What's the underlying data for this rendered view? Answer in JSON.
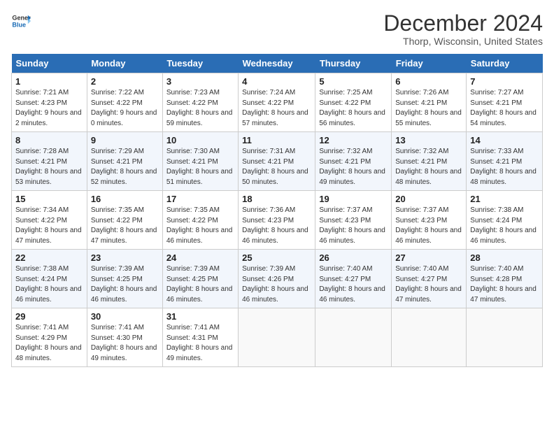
{
  "logo": {
    "line1": "General",
    "line2": "Blue"
  },
  "title": "December 2024",
  "subtitle": "Thorp, Wisconsin, United States",
  "days_header": [
    "Sunday",
    "Monday",
    "Tuesday",
    "Wednesday",
    "Thursday",
    "Friday",
    "Saturday"
  ],
  "weeks": [
    [
      {
        "day": "1",
        "sunrise": "Sunrise: 7:21 AM",
        "sunset": "Sunset: 4:23 PM",
        "daylight": "Daylight: 9 hours and 2 minutes."
      },
      {
        "day": "2",
        "sunrise": "Sunrise: 7:22 AM",
        "sunset": "Sunset: 4:22 PM",
        "daylight": "Daylight: 9 hours and 0 minutes."
      },
      {
        "day": "3",
        "sunrise": "Sunrise: 7:23 AM",
        "sunset": "Sunset: 4:22 PM",
        "daylight": "Daylight: 8 hours and 59 minutes."
      },
      {
        "day": "4",
        "sunrise": "Sunrise: 7:24 AM",
        "sunset": "Sunset: 4:22 PM",
        "daylight": "Daylight: 8 hours and 57 minutes."
      },
      {
        "day": "5",
        "sunrise": "Sunrise: 7:25 AM",
        "sunset": "Sunset: 4:22 PM",
        "daylight": "Daylight: 8 hours and 56 minutes."
      },
      {
        "day": "6",
        "sunrise": "Sunrise: 7:26 AM",
        "sunset": "Sunset: 4:21 PM",
        "daylight": "Daylight: 8 hours and 55 minutes."
      },
      {
        "day": "7",
        "sunrise": "Sunrise: 7:27 AM",
        "sunset": "Sunset: 4:21 PM",
        "daylight": "Daylight: 8 hours and 54 minutes."
      }
    ],
    [
      {
        "day": "8",
        "sunrise": "Sunrise: 7:28 AM",
        "sunset": "Sunset: 4:21 PM",
        "daylight": "Daylight: 8 hours and 53 minutes."
      },
      {
        "day": "9",
        "sunrise": "Sunrise: 7:29 AM",
        "sunset": "Sunset: 4:21 PM",
        "daylight": "Daylight: 8 hours and 52 minutes."
      },
      {
        "day": "10",
        "sunrise": "Sunrise: 7:30 AM",
        "sunset": "Sunset: 4:21 PM",
        "daylight": "Daylight: 8 hours and 51 minutes."
      },
      {
        "day": "11",
        "sunrise": "Sunrise: 7:31 AM",
        "sunset": "Sunset: 4:21 PM",
        "daylight": "Daylight: 8 hours and 50 minutes."
      },
      {
        "day": "12",
        "sunrise": "Sunrise: 7:32 AM",
        "sunset": "Sunset: 4:21 PM",
        "daylight": "Daylight: 8 hours and 49 minutes."
      },
      {
        "day": "13",
        "sunrise": "Sunrise: 7:32 AM",
        "sunset": "Sunset: 4:21 PM",
        "daylight": "Daylight: 8 hours and 48 minutes."
      },
      {
        "day": "14",
        "sunrise": "Sunrise: 7:33 AM",
        "sunset": "Sunset: 4:21 PM",
        "daylight": "Daylight: 8 hours and 48 minutes."
      }
    ],
    [
      {
        "day": "15",
        "sunrise": "Sunrise: 7:34 AM",
        "sunset": "Sunset: 4:22 PM",
        "daylight": "Daylight: 8 hours and 47 minutes."
      },
      {
        "day": "16",
        "sunrise": "Sunrise: 7:35 AM",
        "sunset": "Sunset: 4:22 PM",
        "daylight": "Daylight: 8 hours and 47 minutes."
      },
      {
        "day": "17",
        "sunrise": "Sunrise: 7:35 AM",
        "sunset": "Sunset: 4:22 PM",
        "daylight": "Daylight: 8 hours and 46 minutes."
      },
      {
        "day": "18",
        "sunrise": "Sunrise: 7:36 AM",
        "sunset": "Sunset: 4:23 PM",
        "daylight": "Daylight: 8 hours and 46 minutes."
      },
      {
        "day": "19",
        "sunrise": "Sunrise: 7:37 AM",
        "sunset": "Sunset: 4:23 PM",
        "daylight": "Daylight: 8 hours and 46 minutes."
      },
      {
        "day": "20",
        "sunrise": "Sunrise: 7:37 AM",
        "sunset": "Sunset: 4:23 PM",
        "daylight": "Daylight: 8 hours and 46 minutes."
      },
      {
        "day": "21",
        "sunrise": "Sunrise: 7:38 AM",
        "sunset": "Sunset: 4:24 PM",
        "daylight": "Daylight: 8 hours and 46 minutes."
      }
    ],
    [
      {
        "day": "22",
        "sunrise": "Sunrise: 7:38 AM",
        "sunset": "Sunset: 4:24 PM",
        "daylight": "Daylight: 8 hours and 46 minutes."
      },
      {
        "day": "23",
        "sunrise": "Sunrise: 7:39 AM",
        "sunset": "Sunset: 4:25 PM",
        "daylight": "Daylight: 8 hours and 46 minutes."
      },
      {
        "day": "24",
        "sunrise": "Sunrise: 7:39 AM",
        "sunset": "Sunset: 4:25 PM",
        "daylight": "Daylight: 8 hours and 46 minutes."
      },
      {
        "day": "25",
        "sunrise": "Sunrise: 7:39 AM",
        "sunset": "Sunset: 4:26 PM",
        "daylight": "Daylight: 8 hours and 46 minutes."
      },
      {
        "day": "26",
        "sunrise": "Sunrise: 7:40 AM",
        "sunset": "Sunset: 4:27 PM",
        "daylight": "Daylight: 8 hours and 46 minutes."
      },
      {
        "day": "27",
        "sunrise": "Sunrise: 7:40 AM",
        "sunset": "Sunset: 4:27 PM",
        "daylight": "Daylight: 8 hours and 47 minutes."
      },
      {
        "day": "28",
        "sunrise": "Sunrise: 7:40 AM",
        "sunset": "Sunset: 4:28 PM",
        "daylight": "Daylight: 8 hours and 47 minutes."
      }
    ],
    [
      {
        "day": "29",
        "sunrise": "Sunrise: 7:41 AM",
        "sunset": "Sunset: 4:29 PM",
        "daylight": "Daylight: 8 hours and 48 minutes."
      },
      {
        "day": "30",
        "sunrise": "Sunrise: 7:41 AM",
        "sunset": "Sunset: 4:30 PM",
        "daylight": "Daylight: 8 hours and 49 minutes."
      },
      {
        "day": "31",
        "sunrise": "Sunrise: 7:41 AM",
        "sunset": "Sunset: 4:31 PM",
        "daylight": "Daylight: 8 hours and 49 minutes."
      },
      null,
      null,
      null,
      null
    ]
  ]
}
